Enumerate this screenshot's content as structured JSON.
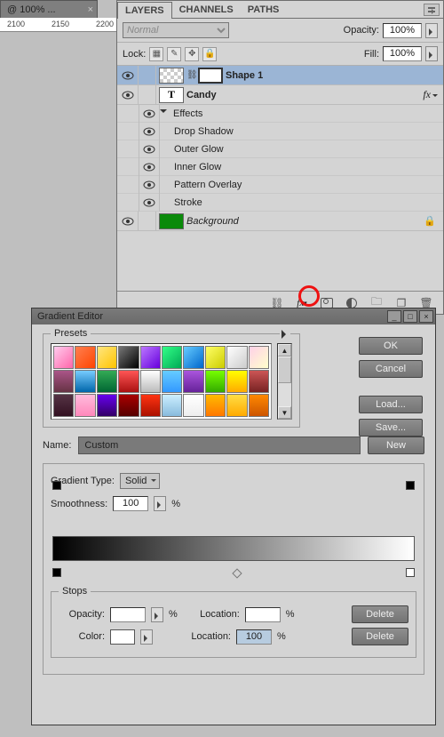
{
  "doc_tab": {
    "title": "@ 100% ...",
    "close": "×"
  },
  "ruler_ticks": [
    "2100",
    "2150",
    "2200"
  ],
  "panel": {
    "tabs": [
      "LAYERS",
      "CHANNELS",
      "PATHS"
    ],
    "blend_mode": "Normal",
    "opacity_label": "Opacity:",
    "opacity_value": "100%",
    "lock_label": "Lock:",
    "fill_label": "Fill:",
    "fill_value": "100%",
    "layers": [
      {
        "name": "Shape 1"
      },
      {
        "name": "Candy"
      },
      {
        "name": "Background"
      }
    ],
    "effects_label": "Effects",
    "effects": [
      "Drop Shadow",
      "Outer Glow",
      "Inner Glow",
      "Pattern Overlay",
      "Stroke"
    ]
  },
  "dialog": {
    "title": "Gradient Editor",
    "presets_label": "Presets",
    "buttons": {
      "ok": "OK",
      "cancel": "Cancel",
      "load": "Load...",
      "save": "Save...",
      "new": "New",
      "delete": "Delete"
    },
    "name_label": "Name:",
    "name_value": "Custom",
    "gtype_label": "Gradient Type:",
    "gtype_value": "Solid",
    "smooth_label": "Smoothness:",
    "smooth_value": "100",
    "percent": "%",
    "stops_label": "Stops",
    "opacity_label": "Opacity:",
    "location_label": "Location:",
    "location_value": "100",
    "color_label": "Color:"
  },
  "swatches": [
    "linear-gradient(135deg,#fce,#f6a)",
    "linear-gradient(135deg,#ff7f50,#ff4500)",
    "linear-gradient(135deg,#ffe680,#ffc400)",
    "linear-gradient(135deg,#777,#000)",
    "linear-gradient(135deg,#b7f,#60d)",
    "linear-gradient(135deg,#3f8,#0a5)",
    "linear-gradient(135deg,#6cf,#06c)",
    "linear-gradient(135deg,#ff6,#cc0)",
    "linear-gradient(135deg,#fff,#ccc)",
    "linear-gradient(135deg,#ffd1e8,#ffc)",
    "linear-gradient(#a58,#634)",
    "linear-gradient(#7cf,#06a)",
    "linear-gradient(#3a5,#063)",
    "linear-gradient(#f55,#a11)",
    "linear-gradient(#fff,#bbb)",
    "linear-gradient(#6cf,#39f)",
    "linear-gradient(#a5d,#629)",
    "linear-gradient(#7f0,#3a0)",
    "linear-gradient(#ff0,#fa0)",
    "linear-gradient(#c55,#722)",
    "linear-gradient(#534,#312)",
    "linear-gradient(#fbd,#f8b)",
    "linear-gradient(#60e,#306)",
    "linear-gradient(#a00,#500)",
    "linear-gradient(#f31,#a10)",
    "linear-gradient(#cef,#8bd)",
    "linear-gradient(#fff,#eee)",
    "linear-gradient(#fb0,#f70)",
    "linear-gradient(#fd4,#fa0)",
    "linear-gradient(#f80,#c50)"
  ]
}
